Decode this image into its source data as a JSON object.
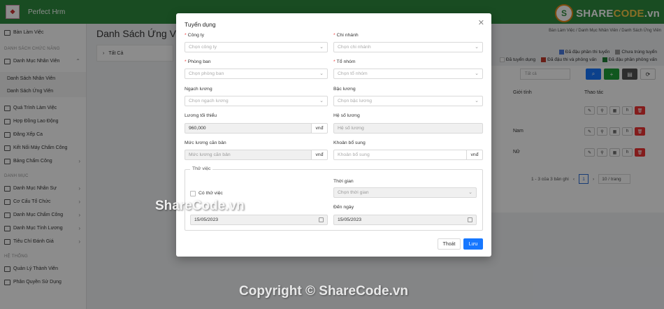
{
  "app": {
    "brand": "Perfect Hrm"
  },
  "sidebar": {
    "top_item": "Bàn Làm Việc",
    "section1": "DANH SÁCH CHỨC NĂNG",
    "group1": "Danh Mục Nhân Viên",
    "sub_items": [
      "Danh Sách Nhân Viên",
      "Danh Sách Ứng Viên"
    ],
    "items1": [
      "Quá Trình Làm Việc",
      "Hợp Đồng Lao Động",
      "Đăng Xếp Ca",
      "Kết Nối Máy Chấm Công",
      "Bảng Chấm Công"
    ],
    "section2": "DANH MỤC",
    "items2": [
      "Danh Mục Nhân Sự",
      "Cơ Cấu Tổ Chức",
      "Danh Mục Chấm Công",
      "Danh Mục Tính Lương",
      "Tiêu Chí Đánh Giá"
    ],
    "section3": "HỆ THỐNG",
    "items3": [
      "Quản Lý Thành Viên",
      "Phân Quyền Sử Dụng"
    ]
  },
  "main": {
    "title": "Danh Sách Ứng Viê",
    "breadcrumb": "Bàn Làm Việc  /  Danh Mục Nhân Viên  /  Danh Sách Ứng Viên",
    "filter_tab": "Tất Cả",
    "legend1": [
      {
        "label": "Đã đậu phần thi tuyển",
        "color": "#4a7be0"
      },
      {
        "label": "Chưa trúng tuyển",
        "color": "#999999"
      }
    ],
    "legend2": [
      {
        "label": "Đã tuyển dụng",
        "color": "#ffffff"
      },
      {
        "label": "Đã đậu thi và phỏng vấn",
        "color": "#c0392b"
      },
      {
        "label": "Đã đậu phần phỏng vấn",
        "color": "#1e7e34"
      }
    ],
    "select_placeholder": "Tất cả",
    "col_gender": "Giới tính",
    "col_actions": "Thao tác",
    "rows": [
      {
        "gender": ""
      },
      {
        "gender": "Nam"
      },
      {
        "gender": "Nữ"
      }
    ],
    "pager_text": "1 - 3 của 3 bản ghi",
    "page": "1",
    "page_size": "10 / trang"
  },
  "modal": {
    "title": "Tuyển dụng",
    "company_label": "Công ty",
    "company_placeholder": "Chọn công ty",
    "branch_label": "Chi nhánh",
    "branch_placeholder": "Chọn chi nhánh",
    "department_label": "Phòng ban",
    "department_placeholder": "Chọn phòng ban",
    "group_label": "Tổ nhóm",
    "group_placeholder": "Chọn tổ nhóm",
    "salary_scale_label": "Ngạch lương",
    "salary_scale_placeholder": "Chọn ngạch lương",
    "salary_grade_label": "Bậc lương",
    "salary_grade_placeholder": "Chọn bậc lương",
    "min_salary_label": "Lương tối thiểu",
    "min_salary_value": "960,000",
    "currency": "vnđ",
    "coef_label": "Hệ số lương",
    "coef_placeholder": "Hệ số lương",
    "base_salary_label": "Mức lương căn bản",
    "base_salary_placeholder": "Mức lương căn bản",
    "extra_label": "Khoản bổ sung",
    "extra_placeholder": "Khoản bổ sung",
    "probation_legend": "Thử việc",
    "probation_checkbox": "Có thử việc",
    "time_label": "Thời gian",
    "time_placeholder": "Chọn thời gian",
    "from_date": "15/05/2023",
    "to_label": "Đến ngày",
    "to_date": "15/05/2023",
    "exit_button": "Thoát",
    "save_button": "Lưu"
  },
  "watermark": {
    "logo_text_a": "SHARE",
    "logo_text_b": "CODE",
    "logo_text_c": ".vn",
    "mid": "ShareCode.vn",
    "bottom": "Copyright © ShareCode.vn"
  }
}
